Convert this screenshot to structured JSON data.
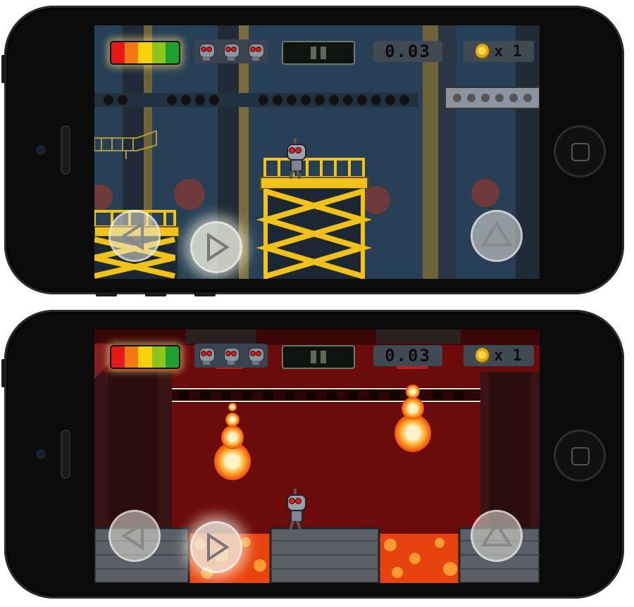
{
  "hud": {
    "battery_colors": [
      "#e3191c",
      "#f07a12",
      "#f5d20d",
      "#8ec51c",
      "#1fa22b"
    ],
    "lives_count": 3,
    "pause_icon": "pause-icon",
    "timer": "0.03",
    "coin_icon": "coin-icon",
    "coins": "x 1"
  },
  "controls": {
    "left_icon": "triangle-left-icon",
    "right_icon": "triangle-right-icon",
    "jump_icon": "triangle-up-icon"
  },
  "scenes": [
    {
      "name": "factory-scaffold-level",
      "background": "#284055",
      "accent": "#f2c316"
    },
    {
      "name": "lava-level",
      "background": "#5a0a0a",
      "accent": "#ff5a10"
    }
  ]
}
